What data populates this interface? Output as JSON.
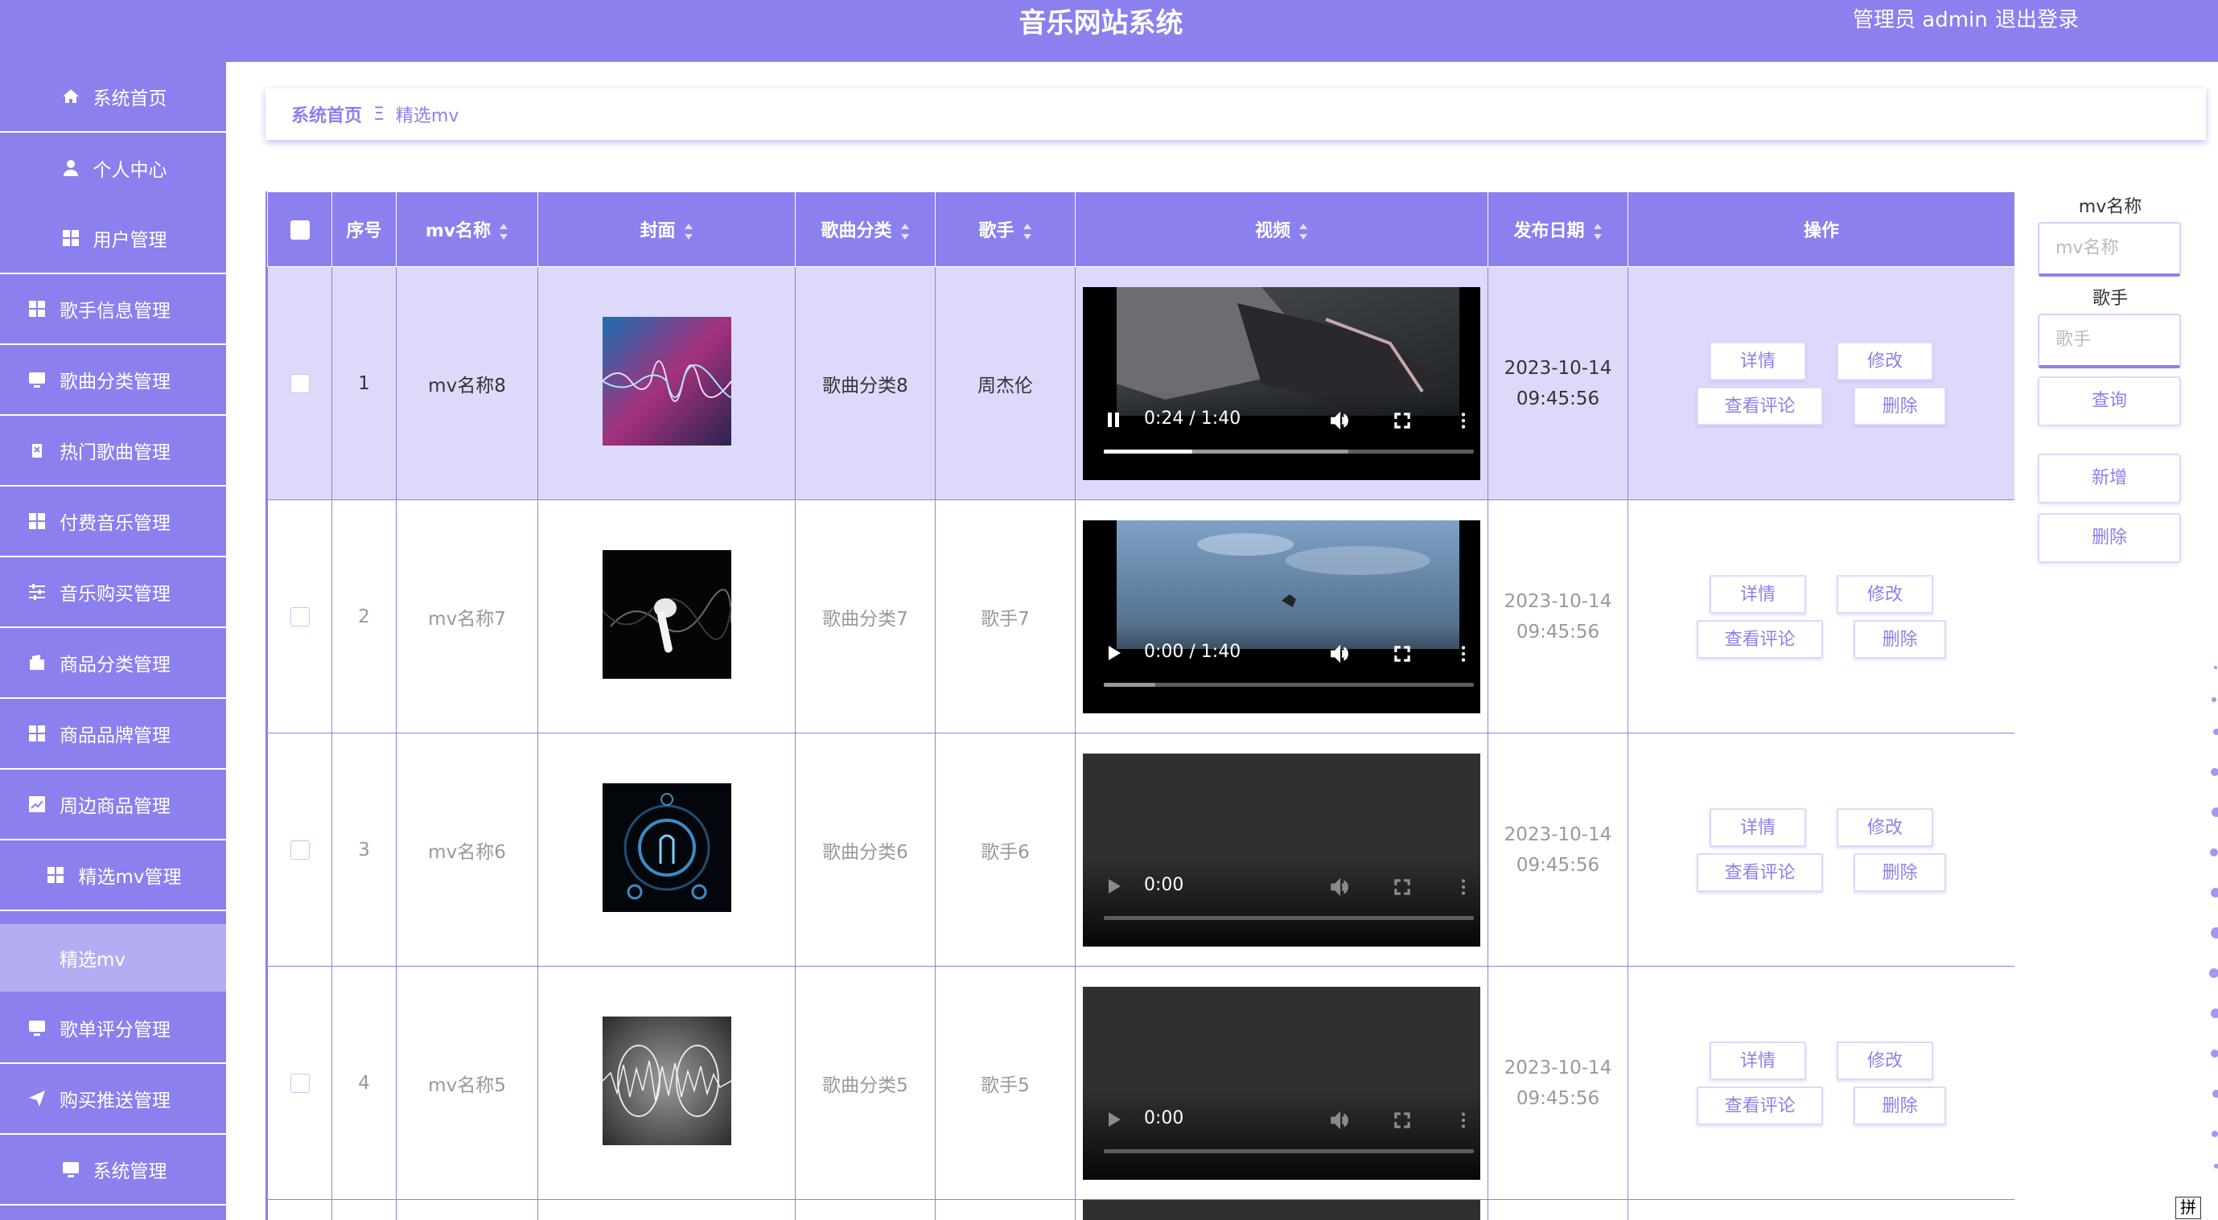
{
  "header": {
    "title": "音乐网站系统",
    "user": "管理员 admin",
    "logout": "退出登录"
  },
  "colors": {
    "accent": "#8b80ee",
    "active_row": "#ddd9fb",
    "submenu": "#b4adf3"
  },
  "sidebar": {
    "items": [
      {
        "label": "系统首页",
        "icon": "home-icon"
      },
      {
        "label": "个人中心",
        "icon": "user-icon"
      },
      {
        "label": "用户管理",
        "icon": "grid-icon"
      },
      {
        "label": "歌手信息管理",
        "icon": "grid-icon"
      },
      {
        "label": "歌曲分类管理",
        "icon": "monitor-icon"
      },
      {
        "label": "热门歌曲管理",
        "icon": "clipboard-icon"
      },
      {
        "label": "付费音乐管理",
        "icon": "grid-icon"
      },
      {
        "label": "音乐购买管理",
        "icon": "sliders-icon"
      },
      {
        "label": "商品分类管理",
        "icon": "wallet-icon"
      },
      {
        "label": "商品品牌管理",
        "icon": "grid-icon"
      },
      {
        "label": "周边商品管理",
        "icon": "chart-icon"
      },
      {
        "label": "精选mv管理",
        "icon": "grid-icon"
      },
      {
        "label": "歌单评分管理",
        "icon": "monitor-icon"
      },
      {
        "label": "购买推送管理",
        "icon": "send-icon"
      },
      {
        "label": "系统管理",
        "icon": "monitor-icon"
      }
    ],
    "submenu_active": "精选mv"
  },
  "breadcrumb": {
    "home": "系统首页",
    "separator": "Ξ",
    "current": "精选mv"
  },
  "table": {
    "columns": [
      "序号",
      "mv名称",
      "封面",
      "歌曲分类",
      "歌手",
      "视频",
      "发布日期",
      "操作"
    ],
    "rows": [
      {
        "index": "1",
        "name": "mv名称8",
        "category": "歌曲分类8",
        "singer": "周杰伦",
        "date": "2023-10-14",
        "time": "09:45:56",
        "video_time": "0:24 / 1:40",
        "video_state": "playing",
        "video_progress": 0.24,
        "video_buffered": 0.66,
        "cover": "pink-wave-icon"
      },
      {
        "index": "2",
        "name": "mv名称7",
        "category": "歌曲分类7",
        "singer": "歌手7",
        "date": "2023-10-14",
        "time": "09:45:56",
        "video_time": "0:00 / 1:40",
        "video_state": "paused",
        "video_progress": 0.0,
        "video_buffered": 0.14,
        "cover": "earbud-icon"
      },
      {
        "index": "3",
        "name": "mv名称6",
        "category": "歌曲分类6",
        "singer": "歌手6",
        "date": "2023-10-14",
        "time": "09:45:56",
        "video_time": "0:00",
        "video_state": "empty",
        "video_progress": 0.0,
        "video_buffered": 0.0,
        "cover": "speaker-icon"
      },
      {
        "index": "4",
        "name": "mv名称5",
        "category": "歌曲分类5",
        "singer": "歌手5",
        "date": "2023-10-14",
        "time": "09:45:56",
        "video_time": "0:00",
        "video_state": "empty",
        "video_progress": 0.0,
        "video_buffered": 0.0,
        "cover": "grey-wave-icon"
      }
    ],
    "actions": {
      "detail": "详情",
      "edit": "修改",
      "comments": "查看评论",
      "delete": "删除"
    }
  },
  "search": {
    "name_label": "mv名称",
    "name_placeholder": "mv名称",
    "singer_label": "歌手",
    "singer_placeholder": "歌手",
    "query": "查询",
    "add": "新增",
    "delete": "删除"
  },
  "ime_indicator": "拼"
}
